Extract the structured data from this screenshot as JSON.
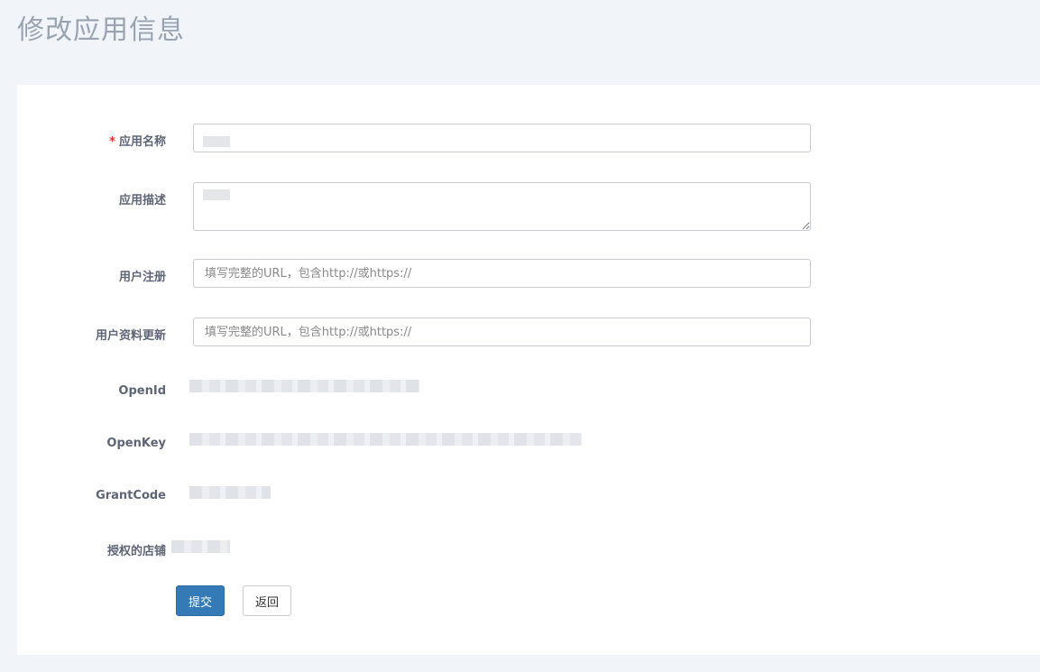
{
  "page": {
    "title": "修改应用信息"
  },
  "form": {
    "app_name": {
      "label": "应用名称",
      "required_mark": "*",
      "value": ""
    },
    "app_desc": {
      "label": "应用描述",
      "value": ""
    },
    "user_register": {
      "label": "用户注册",
      "placeholder": "填写完整的URL，包含http://或https://",
      "value": ""
    },
    "user_profile_update": {
      "label": "用户资料更新",
      "placeholder": "填写完整的URL，包含http://或https://",
      "value": ""
    },
    "open_id": {
      "label": "OpenId"
    },
    "open_key": {
      "label": "OpenKey"
    },
    "grant_code": {
      "label": "GrantCode"
    },
    "authorized_shops": {
      "label": "授权的店铺"
    }
  },
  "actions": {
    "submit_label": "提交",
    "back_label": "返回"
  },
  "colors": {
    "primary": "#337ab7",
    "required": "#e0353b",
    "background": "#f1f4f9"
  }
}
